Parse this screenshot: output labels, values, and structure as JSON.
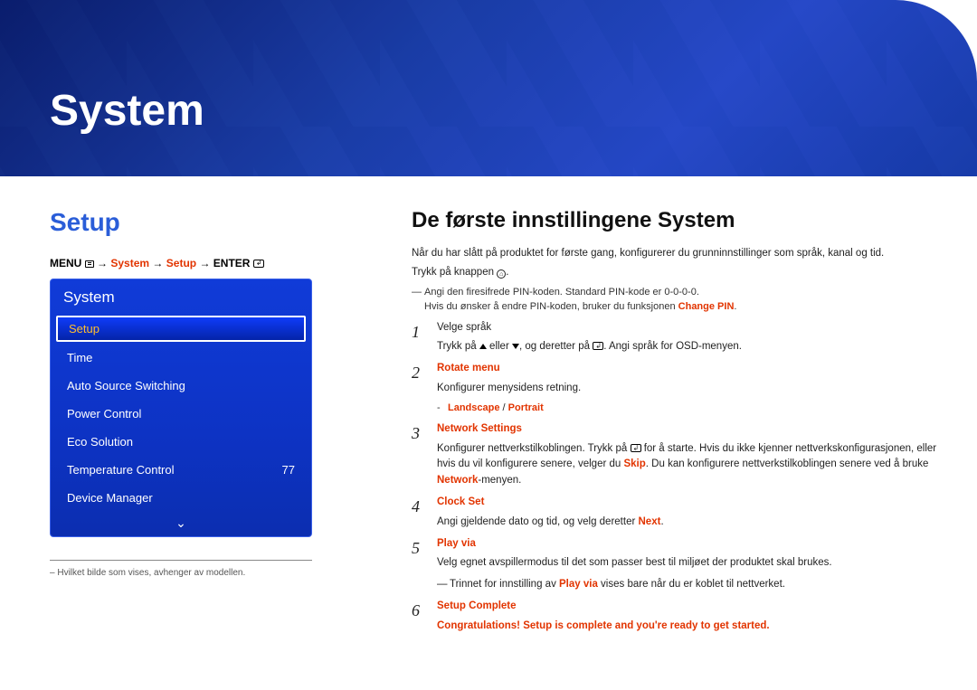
{
  "header": {
    "title": "System"
  },
  "left": {
    "heading": "Setup",
    "breadcrumb": {
      "menu": "MENU",
      "arrow": "→",
      "system": "System",
      "setup": "Setup",
      "enter": "ENTER"
    },
    "osd": {
      "title": "System",
      "items": [
        {
          "label": "Setup",
          "value": "",
          "highlight": true
        },
        {
          "label": "Time",
          "value": ""
        },
        {
          "label": "Auto Source Switching",
          "value": ""
        },
        {
          "label": "Power Control",
          "value": ""
        },
        {
          "label": "Eco Solution",
          "value": ""
        },
        {
          "label": "Temperature Control",
          "value": "77"
        },
        {
          "label": "Device Manager",
          "value": ""
        }
      ]
    },
    "footnote": "Hvilket bilde som vises, avhenger av modellen."
  },
  "right": {
    "heading": "De første innstillingene System",
    "intro1": "Når du har slått på produktet for første gang, konfigurerer du grunninnstillinger som språk, kanal og tid.",
    "intro2_pre": "Trykk på knappen ",
    "intro2_post": ".",
    "pin_note_pre": "Angi den firesifrede PIN-koden. Standard PIN-kode er 0-0-0-0.",
    "pin_note_line2_pre": "Hvis du ønsker å endre PIN-koden, bruker du funksjonen ",
    "pin_note_line2_red": "Change PIN",
    "pin_note_line2_post": ".",
    "steps": {
      "s1": {
        "num": "1",
        "line1": "Velge språk",
        "line2_pre": "Trykk på ",
        "line2_mid": " eller ",
        "line2_mid2": ", og deretter på ",
        "line2_post": ". Angi språk for OSD-menyen."
      },
      "s2": {
        "num": "2",
        "title": "Rotate menu",
        "line1": "Konfigurer menysidens retning.",
        "opt_dash": "Landscape / Portrait",
        "opt_a": "Landscape",
        "slash": " / ",
        "opt_b": "Portrait"
      },
      "s3": {
        "num": "3",
        "title": "Network Settings",
        "line1_pre": "Konfigurer nettverkstilkoblingen. Trykk på ",
        "line1_mid": " for å starte. Hvis du ikke kjenner nettverkskonfigurasjonen, eller hvis du vil konfigurere senere, velger du ",
        "skip": "Skip",
        "line1_post_pre": ". Du kan konfigurere nettverkstilkoblingen senere ved å bruke ",
        "network": "Network",
        "line1_post_post": "-menyen."
      },
      "s4": {
        "num": "4",
        "title": "Clock Set",
        "line1_pre": "Angi gjeldende dato og tid, og velg deretter ",
        "next": "Next",
        "line1_post": "."
      },
      "s5": {
        "num": "5",
        "title": "Play via",
        "line1": "Velg egnet avspillermodus til det som passer best til miljøet der produktet skal brukes.",
        "note_pre": "Trinnet for innstilling av ",
        "note_red": "Play via",
        "note_post": " vises bare når du er koblet til nettverket."
      },
      "s6": {
        "num": "6",
        "title": "Setup Complete",
        "line1": "Congratulations! Setup is complete and you're ready to get started."
      }
    }
  }
}
